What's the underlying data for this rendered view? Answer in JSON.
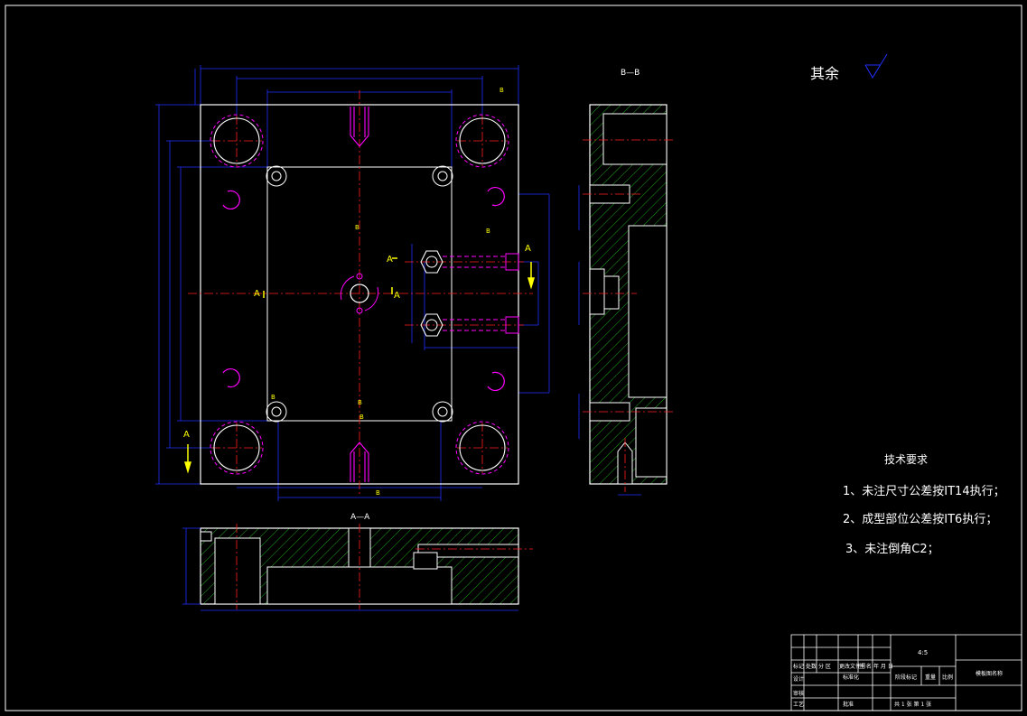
{
  "drawing": {
    "top_view": {
      "section_labels": [
        "A",
        "A",
        "A",
        "A",
        "A"
      ],
      "b_labels": [
        "B",
        "B",
        "B",
        "B",
        "B",
        "B",
        "B"
      ]
    },
    "section_aa": {
      "title": "A—A"
    },
    "section_bb": {
      "title": "B—B"
    },
    "surface_finish": {
      "label": "其余"
    },
    "tech_requirements": {
      "title": "技术要求",
      "items": [
        "1、未注尺寸公差按IT14执行；",
        "2、成型部位公差按IT6执行；",
        "3、未注倒角C2；"
      ]
    },
    "title_block": {
      "scale": "4:5",
      "headers_row1": [
        "标记",
        "处数",
        "分 区",
        "更改文件号",
        "签 名",
        "年 月 日"
      ],
      "headers_row2": [
        "设计",
        "标准化"
      ],
      "headers_row3": [
        "审核"
      ],
      "headers_row4": [
        "工艺",
        "批准"
      ],
      "stage_label": "阶段标记",
      "weight_label": "重量",
      "scale_label": "比例",
      "sheet_info": "共 1 张  第 1 张",
      "drawing_name": "模板图名称"
    }
  },
  "colors": {
    "background": "#000000",
    "outline": "#ffffff",
    "centerline": "#ff0000",
    "dimension": "#0000ff",
    "hidden": "#ff00ff",
    "hatch": "#00cc00",
    "section_arrow": "#ffff00"
  }
}
